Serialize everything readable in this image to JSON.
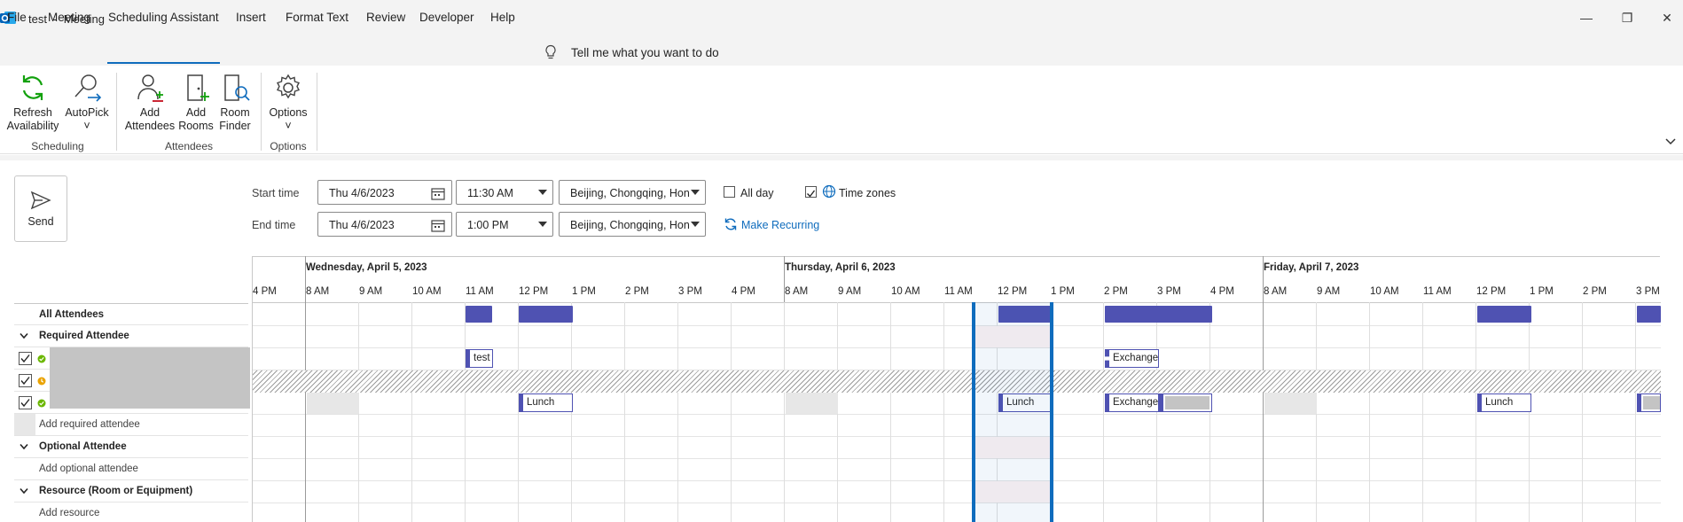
{
  "window": {
    "title": "test  -  Meeting",
    "app_icon": "outlook-icon"
  },
  "menu": {
    "tabs": [
      "File",
      "Meeting",
      "Scheduling Assistant",
      "Insert",
      "Format Text",
      "Review",
      "Developer",
      "Help"
    ],
    "active_tab": "Scheduling Assistant",
    "tell_me": "Tell me what you want to do"
  },
  "ribbon": {
    "groups": [
      {
        "name": "Scheduling",
        "buttons": [
          {
            "line1": "Refresh",
            "line2": "Availability"
          },
          {
            "line1": "AutoPick",
            "line2": "˅"
          }
        ]
      },
      {
        "name": "Attendees",
        "buttons": [
          {
            "line1": "Add",
            "line2": "Attendees"
          },
          {
            "line1": "Add",
            "line2": "Rooms"
          },
          {
            "line1": "Room",
            "line2": "Finder"
          }
        ]
      },
      {
        "name": "Options",
        "buttons": [
          {
            "line1": "Options",
            "line2": "˅"
          }
        ]
      }
    ]
  },
  "form": {
    "send_label": "Send",
    "start_label": "Start time",
    "end_label": "End time",
    "start_date": "Thu 4/6/2023",
    "start_time": "11:30 AM",
    "end_date": "Thu 4/6/2023",
    "end_time": "1:00 PM",
    "timezone_start": "Beijing, Chongqing, Hon",
    "timezone_end": "Beijing, Chongqing, Hon",
    "all_day_label": "All day",
    "all_day_checked": false,
    "time_zones_label": "Time zones",
    "time_zones_checked": true,
    "make_recurring": "Make Recurring"
  },
  "attendees": {
    "all_label": "All Attendees",
    "required_header": "Required Attendee",
    "add_required": "Add required attendee",
    "optional_header": "Optional Attendee",
    "add_optional": "Add optional attendee",
    "resource_header": "Resource (Room or Equipment)",
    "add_resource": "Add resource",
    "rows": [
      {
        "status": "available",
        "status_color": "#6bb700"
      },
      {
        "status": "unknown",
        "status_color": "#eaa300"
      },
      {
        "status": "available",
        "status_color": "#6bb700"
      }
    ]
  },
  "schedule": {
    "days": [
      "Wednesday, April 5, 2023",
      "Thursday, April 6, 2023",
      "Friday, April 7, 2023"
    ],
    "hours_prefix": "4 PM",
    "hours": [
      "8 AM",
      "9 AM",
      "10 AM",
      "11 AM",
      "12 PM",
      "1 PM",
      "2 PM",
      "3 PM",
      "4 PM"
    ],
    "hours_last_day": [
      "8 AM",
      "9 AM",
      "10 AM",
      "11 AM",
      "12 PM",
      "1 PM",
      "2 PM",
      "3 PM"
    ],
    "appointments": {
      "test": "test",
      "exchange": "Exchange",
      "lunch": "Lunch"
    },
    "colors": {
      "busy": "#4f52b2",
      "selection": "#0f6cbd"
    }
  }
}
